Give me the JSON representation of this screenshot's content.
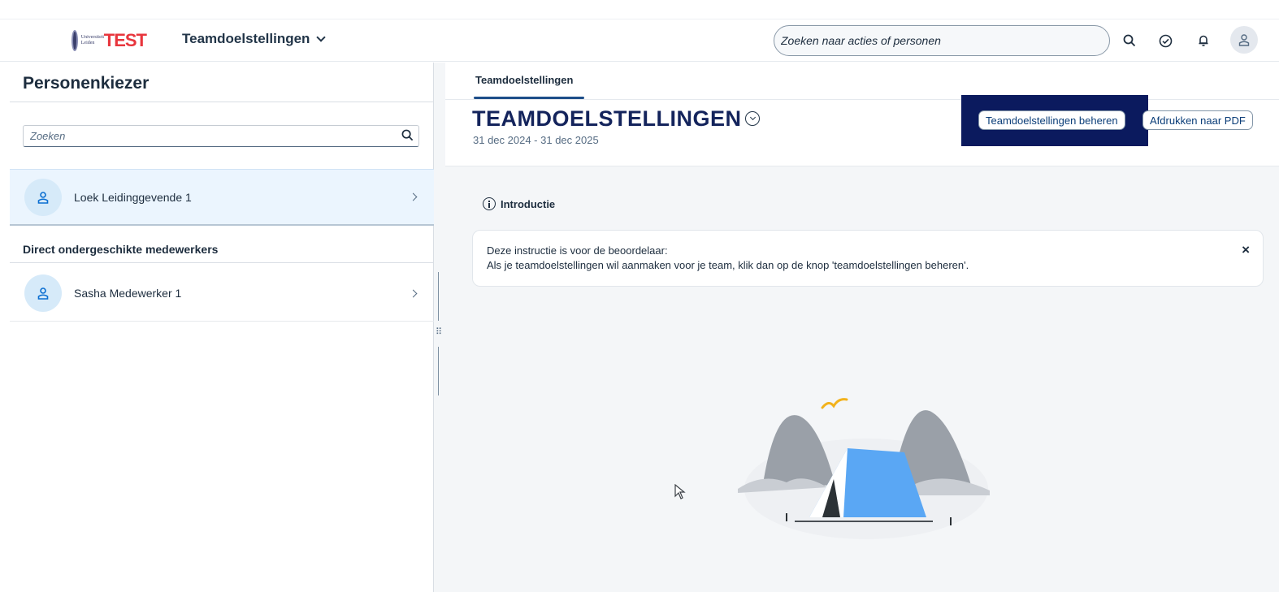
{
  "topbar": {
    "logo_small": "Universiteit Leiden",
    "logo_main": "TEST",
    "app_title": "Teamdoelstellingen",
    "search_placeholder": "Zoeken naar acties of personen",
    "icons": [
      "search-icon",
      "task-check-icon",
      "bell-icon",
      "user-icon"
    ]
  },
  "left": {
    "title": "Personenkiezer",
    "search_placeholder": "Zoeken",
    "manager": {
      "name": "Loek Leidinggevende 1"
    },
    "group_title": "Direct ondergeschikte medewerkers",
    "reports": [
      {
        "name": "Sasha Medewerker 1"
      }
    ]
  },
  "main": {
    "tab": "Teamdoelstellingen",
    "title": "TEAMDOELSTELLINGEN",
    "period": "31 dec 2024 - 31 dec 2025",
    "manage_button": "Teamdoelstellingen beheren",
    "pdf_button": "Afdrukken naar PDF",
    "intro": {
      "heading": "Introductie",
      "line1": "Deze instructie is voor de beoordelaar:",
      "line2": "Als je teamdoelstellingen wil aanmaken voor je team, klik dan op de knop 'teamdoelstellingen beheren'.",
      "close": "×"
    }
  },
  "colors": {
    "accent": "#0a3d78",
    "title_navy": "#14245c",
    "highlight_box": "#0b1a5e",
    "selected_row": "#ebf5fe",
    "logo_red": "#e8363d"
  }
}
